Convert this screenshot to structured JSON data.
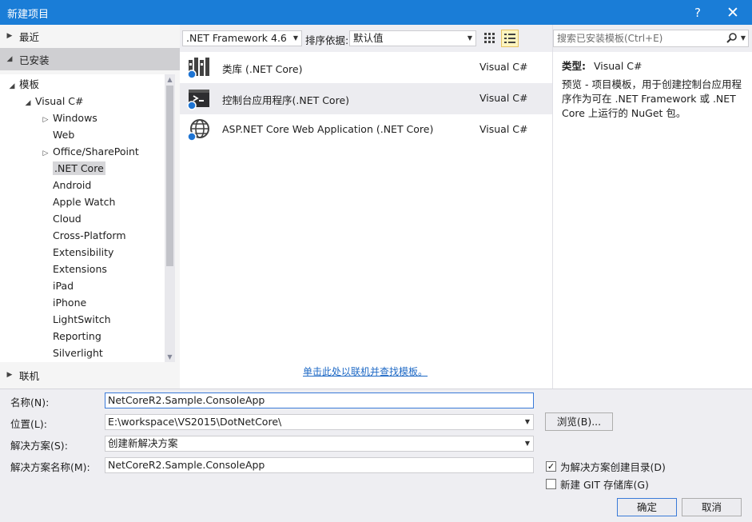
{
  "window": {
    "title": "新建项目",
    "help_label": "?",
    "close_label": "✕"
  },
  "left": {
    "recent": "最近",
    "installed": "已安装",
    "online": "联机",
    "tree": {
      "templates": "模板",
      "visual_csharp": "Visual C#",
      "children": [
        "Windows",
        "Web",
        "Office/SharePoint",
        ".NET Core",
        "Android",
        "Apple Watch",
        "Cloud",
        "Cross-Platform",
        "Extensibility",
        "Extensions",
        "iPad",
        "iPhone",
        "LightSwitch",
        "Reporting",
        "Silverlight"
      ],
      "selected": ".NET Core"
    }
  },
  "toolbar": {
    "framework": ".NET Framework 4.6",
    "sort_label": "排序依据:",
    "sort_value": "默认值"
  },
  "templates": [
    {
      "name": "类库 (.NET Core)",
      "lang": "Visual C#",
      "icon": "class-library-icon"
    },
    {
      "name": "控制台应用程序(.NET Core)",
      "lang": "Visual C#",
      "icon": "console-app-icon"
    },
    {
      "name": "ASP.NET Core Web Application (.NET Core)",
      "lang": "Visual C#",
      "icon": "web-app-icon"
    }
  ],
  "selected_template": 1,
  "online_link": "单击此处以联机并查找模板。",
  "search": {
    "placeholder": "搜索已安装模板(Ctrl+E)"
  },
  "details": {
    "type_label": "类型:",
    "type_value": "Visual C#",
    "description": "预览 - 项目模板，用于创建控制台应用程序作为可在 .NET Framework 或 .NET Core 上运行的 NuGet 包。"
  },
  "form": {
    "name_label": "名称(N):",
    "name_value": "NetCoreR2.Sample.ConsoleApp",
    "location_label": "位置(L):",
    "location_value": "E:\\workspace\\VS2015\\DotNetCore\\",
    "solution_label": "解决方案(S):",
    "solution_value": "创建新解决方案",
    "solution_name_label": "解决方案名称(M):",
    "solution_name_value": "NetCoreR2.Sample.ConsoleApp",
    "browse_label": "浏览(B)...",
    "create_dir_label": "为解决方案创建目录(D)",
    "create_dir_checked": true,
    "git_label": "新建 GIT 存储库(G)",
    "git_checked": false,
    "ok_label": "确定",
    "cancel_label": "取消"
  },
  "colors": {
    "titlebar": "#1a7dd7",
    "accent": "#3a7ad8",
    "link": "#1e69c5"
  }
}
